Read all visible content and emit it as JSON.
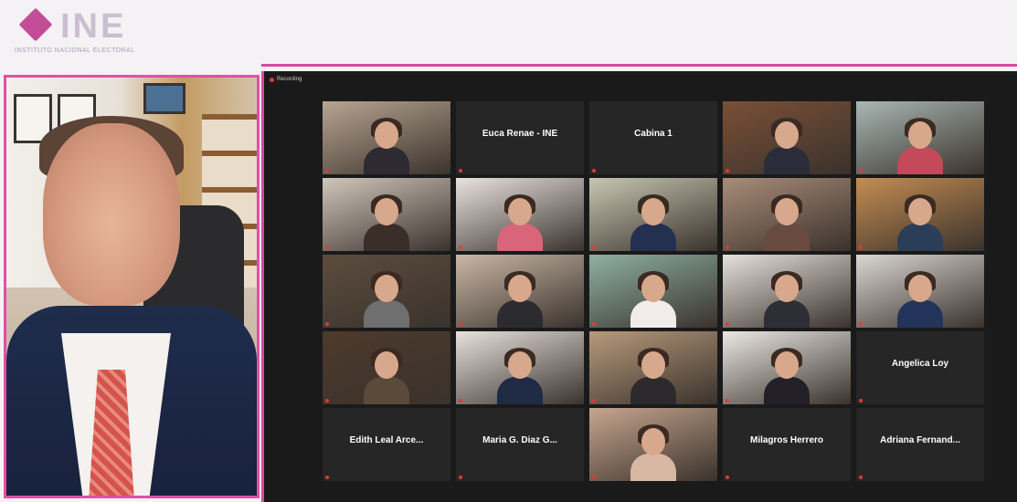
{
  "header": {
    "logo_text": "INE",
    "logo_subtitle": "INSTITUTO NACIONAL ELECTORAL"
  },
  "meeting": {
    "recording_label": "Recording"
  },
  "colors": {
    "accent": "#d64a9e",
    "logo_mark": "#c44d97",
    "tile_bg": "#262626",
    "mic_muted": "#e03a3a"
  },
  "tiles": [
    {
      "type": "video",
      "display": "",
      "caption": "",
      "bg": "#b8a592",
      "shirt": "#2e2a33"
    },
    {
      "type": "name",
      "display": "Euca Renae - INE",
      "caption": ""
    },
    {
      "type": "name",
      "display": "Cabina 1",
      "caption": ""
    },
    {
      "type": "video",
      "display": "",
      "caption": "",
      "bg": "#7a4f36",
      "shirt": "#2a2c3a"
    },
    {
      "type": "video",
      "display": "",
      "caption": "",
      "bg": "#a9b7b4",
      "shirt": "#c24a5a"
    },
    {
      "type": "video",
      "display": "",
      "caption": "",
      "bg": "#cfc6bb",
      "shirt": "#3b2d2a"
    },
    {
      "type": "video",
      "display": "",
      "caption": "",
      "bg": "#e9e3df",
      "shirt": "#d9657a"
    },
    {
      "type": "video",
      "display": "",
      "caption": "",
      "bg": "#c7c6b2",
      "shirt": "#243050"
    },
    {
      "type": "video",
      "display": "",
      "caption": "",
      "bg": "#a98c78",
      "shirt": "#6a4b42"
    },
    {
      "type": "video",
      "display": "",
      "caption": "",
      "bg": "#c48d52",
      "shirt": "#2a3e57"
    },
    {
      "type": "video",
      "display": "",
      "caption": "",
      "bg": "#5c4c3e",
      "shirt": "#6f6f6f"
    },
    {
      "type": "video",
      "display": "",
      "caption": "",
      "bg": "#c9b7a6",
      "shirt": "#2b2b30"
    },
    {
      "type": "video",
      "display": "",
      "caption": "",
      "bg": "#8eb1a3",
      "shirt": "#f1ecea"
    },
    {
      "type": "video",
      "display": "",
      "caption": "",
      "bg": "#e6e1dc",
      "shirt": "#2e2e36"
    },
    {
      "type": "video",
      "display": "",
      "caption": "",
      "bg": "#dad7d2",
      "shirt": "#22345a"
    },
    {
      "type": "video",
      "display": "",
      "caption": "",
      "bg": "#4d3a2c",
      "shirt": "#5a4a3a"
    },
    {
      "type": "video",
      "display": "",
      "caption": "",
      "bg": "#e8e2dc",
      "shirt": "#1f2a44"
    },
    {
      "type": "video",
      "display": "",
      "caption": "",
      "bg": "#b79a7c",
      "shirt": "#2c2a2c"
    },
    {
      "type": "video",
      "display": "",
      "caption": "",
      "bg": "#ebe8e4",
      "shirt": "#23202a"
    },
    {
      "type": "name",
      "display": "Angelica Loy",
      "caption": ""
    },
    {
      "type": "name",
      "display": "Edith Leal Arce...",
      "caption": ""
    },
    {
      "type": "name",
      "display": "Maria G. Diaz G...",
      "caption": ""
    },
    {
      "type": "video",
      "display": "",
      "caption": "",
      "bg": "#c7a58f",
      "shirt": "#d8b7a3"
    },
    {
      "type": "name",
      "display": "Milagros Herrero",
      "caption": ""
    },
    {
      "type": "name",
      "display": "Adriana Fernand...",
      "caption": ""
    }
  ]
}
